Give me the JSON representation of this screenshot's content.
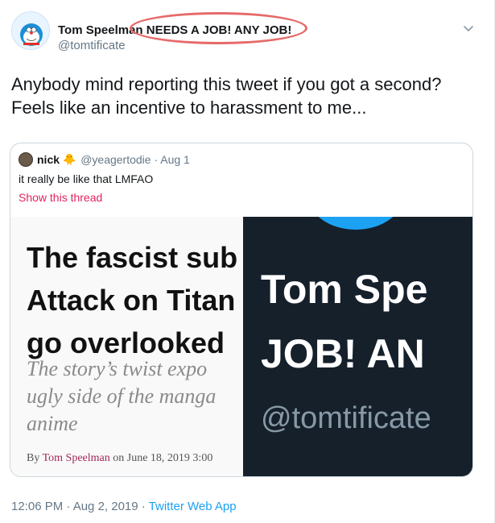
{
  "tweet": {
    "author_name": "Tom Speelman NEEDS A JOB! ANY JOB!",
    "author_handle": "@tomtificate",
    "text_line_1": "Anybody mind reporting this tweet if you got a second?",
    "text_line_2": "Feels like an incentive to harassment to me...",
    "timestamp": "12:06 PM · Aug 2, 2019 · ",
    "source_app": "Twitter Web App"
  },
  "quote": {
    "author_name": "nick",
    "author_emoji": "🐥",
    "author_handle": "@yeagertodie · Aug 1",
    "text": "it really be like that LMFAO",
    "show_thread": "Show this thread",
    "article": {
      "headline_lines": [
        "The fascist sub",
        "Attack on Titan",
        "go overlooked"
      ],
      "subtitle_lines": [
        "The story’s twist expo",
        "ugly side of the manga",
        "anime"
      ],
      "byline_prefix": "By ",
      "byline_author": "Tom Speelman",
      "byline_suffix": " on June 18, 2019 3:00"
    },
    "profile_crop": {
      "name": "Tom Spe",
      "tagline": "JOB! AN",
      "handle": "@tomtificate"
    }
  },
  "icons": {
    "avatar": "doraemon-avatar-icon",
    "caret": "chevron-down-icon",
    "annotation": "red-ellipse-annotation"
  },
  "colors": {
    "link": "#1da1f2",
    "thread_link": "#e0245e",
    "annotation": "#e66a6a",
    "dark_panel": "#15202b"
  }
}
